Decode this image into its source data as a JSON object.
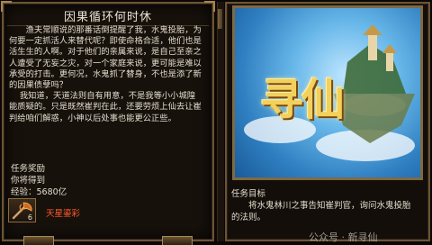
{
  "left_panel": {
    "title": "因果循环何时休",
    "story": "渔夫常顺说的那番话倒提醒了我，水鬼投胎，为何要一定抓活人来替代呢？即使命格合适，他们也是活生生的人啊。对于他们的亲属来说，是自己至亲之人遭受了无妄之灾，对一个家庭来说，更可能是难以承受的打击。更何况，水鬼抓了替身，不也是添了新的因果债孽吗？\n    我知道，天道法则自有用意，不是我等小小城隍能质疑的。只是既然崔判在此，还要劳烦上仙去让崔判给咱们解惑，小神以后处事也能更公正些。",
    "reward_heading": "任务奖励",
    "reward_gain_label": "你将得到",
    "reward_exp": "经验：5680亿",
    "item": {
      "name": "天星鎏彩",
      "count": "6",
      "icon": "axe-icon"
    }
  },
  "right_panel": {
    "art": {
      "logo_text": "寻仙",
      "sky_color": "#69b8ea",
      "logo_color": "#f3d05a"
    },
    "goal_heading": "任务目标",
    "goal_text": "将水鬼林川之事告知崔判官，询问水鬼投胎的法则。"
  },
  "watermark": {
    "text": "公众号 · 新寻仙"
  },
  "colors": {
    "frame": "#6b5436",
    "item_name": "#ff5a2a"
  }
}
